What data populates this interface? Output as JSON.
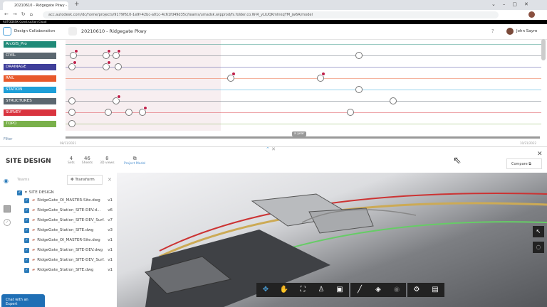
{
  "browser": {
    "tab_title": "20210610 - Ridgegate Pkwy - A",
    "url": "acc.autodesk.com/dc/home/projects/9179f610-1e9f-42bc-a01c-4c61fd49d35c/teams/umadsk.wipprod/fs.folder.co.W-R_yLiUQKmlnkqTM_jw6A/model"
  },
  "brand": "AUTODESK Construction Cloud",
  "header": {
    "module": "Design Collaboration",
    "package": "20210610 - Ridgegate Pkwy",
    "user": "John Sayre"
  },
  "timeline": {
    "teams": [
      {
        "label": "ArcGIS_Pro",
        "color": "#1f8a78"
      },
      {
        "label": "CIVIL",
        "color": "#5b6770"
      },
      {
        "label": "DRAINAGE",
        "color": "#3f3f9a"
      },
      {
        "label": "RAIL",
        "color": "#e8592b"
      },
      {
        "label": "STATION",
        "color": "#1e9fd8"
      },
      {
        "label": "STRUCTURES",
        "color": "#5b6770"
      },
      {
        "label": "SURVEY",
        "color": "#d9343f"
      },
      {
        "label": "TOPO",
        "color": "#79b04a"
      }
    ],
    "filter": "Filter",
    "span": "a year",
    "start_date": "08/11/2021",
    "end_date": "10/21/2022"
  },
  "panel": {
    "title": "SITE DESIGN",
    "stats": [
      {
        "value": "4",
        "label": "Sets"
      },
      {
        "value": "46",
        "label": "Sheets"
      },
      {
        "value": "8",
        "label": "3D views"
      }
    ],
    "project_model": "Project Model",
    "compare": "Compare",
    "teams_label": "Teams",
    "transform": "Transform",
    "folder": "SITE DESIGN",
    "files": [
      {
        "name": "RidgeGate_OI_MASTER-Site.dwg",
        "version": "v1"
      },
      {
        "name": "RidgeGate_Station_SITE-DEV.d...",
        "version": "v6"
      },
      {
        "name": "RidgeGate_Station_SITE-DEV_Surf...",
        "version": "v7"
      },
      {
        "name": "RidgeGate_Station_SITE.dwg",
        "version": "v3"
      },
      {
        "name": "RidgeGate_OI_MASTER-Site.dwg",
        "version": "v1"
      },
      {
        "name": "RidgeGate_Station_SITE-DEV.dwg",
        "version": "v1"
      },
      {
        "name": "RidgeGate_Station_SITE-DEV_Surf...",
        "version": "v1"
      },
      {
        "name": "RidgeGate_Station_SITE.dwg",
        "version": "v1"
      }
    ]
  },
  "chat": "Chat with an Expert"
}
